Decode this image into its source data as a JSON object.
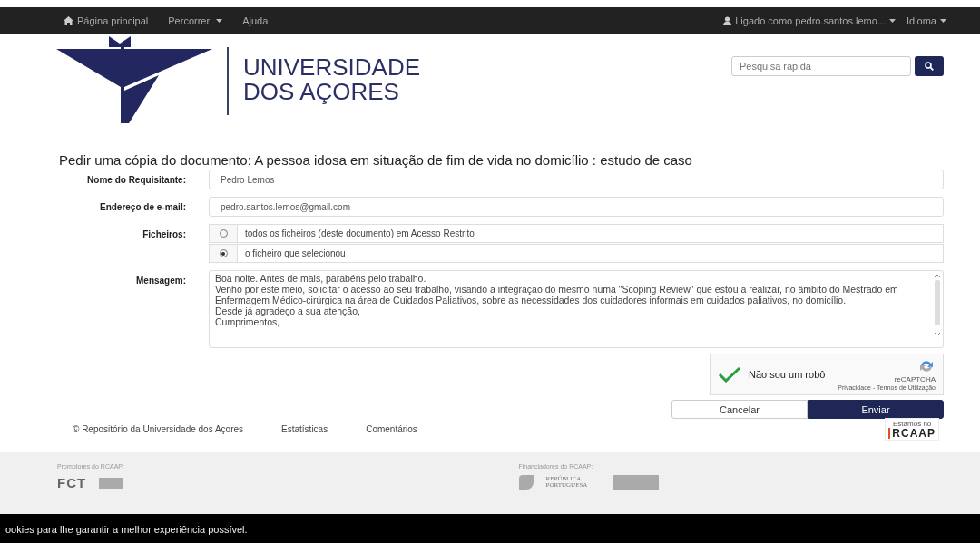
{
  "navbar": {
    "items": [
      {
        "kind": "home",
        "label": "Página principal"
      },
      {
        "kind": "dropdown",
        "label": "Percorrer:"
      },
      {
        "kind": "link",
        "label": "Ajuda"
      }
    ],
    "right_items": [
      {
        "kind": "user",
        "label": "Ligado como pedro.santos.lemo..."
      },
      {
        "kind": "dropdown",
        "label": "Idioma"
      }
    ]
  },
  "header": {
    "logo_line_1": "UNIVERSIDADE",
    "logo_line_2": "DOS AÇORES",
    "search": {
      "placeholder": "Pesquisa rápida"
    }
  },
  "form": {
    "title": "Pedir uma cópia do documento: A pessoa idosa em situação de fim de vida no domicílio : estudo de caso",
    "name_label": "Nome do Requisitante:",
    "name_value": "Pedro Lemos",
    "email_label": "Endereço de e-mail:",
    "email_value": "pedro.santos.lemos@gmail.com",
    "files_label": "Ficheiros:",
    "files_options": [
      {
        "label": "todos os ficheiros (deste documento) em Acesso Restrito",
        "selected": false
      },
      {
        "label": "o ficheiro que selecionou",
        "selected": true
      }
    ],
    "message_label": "Mensagem:",
    "message_lines": [
      "Boa noite. Antes de mais, parabéns pelo trabalho.",
      "Venho por este meio, solicitar o acesso ao seu trabalho, visando a integração do mesmo numa \"Scoping Review\" que estou a realizar, no âmbito do Mestrado em Enfermagem Médico-cirúrgica na área de Cuidados Paliativos, sobre as necessidades dos cuidadores informais em cuidados paliativos, no domicílio.",
      "Desde já agradeço a sua atenção,",
      "Cumprimentos,"
    ],
    "captcha": {
      "checked": true,
      "label": "Não sou um robô",
      "brand": "reCAPTCHA",
      "links": "Privacidade - Termos de Utilização"
    },
    "buttons": [
      {
        "kind": "secondary",
        "label": "Cancelar"
      },
      {
        "kind": "primary",
        "label": "Enviar"
      }
    ]
  },
  "footer": {
    "links": [
      "© Repositório da Universidade dos Açores",
      "Estatísticas",
      "Comentários"
    ],
    "badge_top": "Estamos no",
    "badge_bottom": "RCAAP",
    "promoters_label": "Promotores do RCAAP:",
    "promoter_logo": "FCT",
    "funders_label": "Financiadores do RCAAP:",
    "funder_logo": "REPÚBLICA PORTUGUESA"
  },
  "cookie_bar": {
    "text": "ookies para lhe garantir a melhor experiência possível."
  }
}
